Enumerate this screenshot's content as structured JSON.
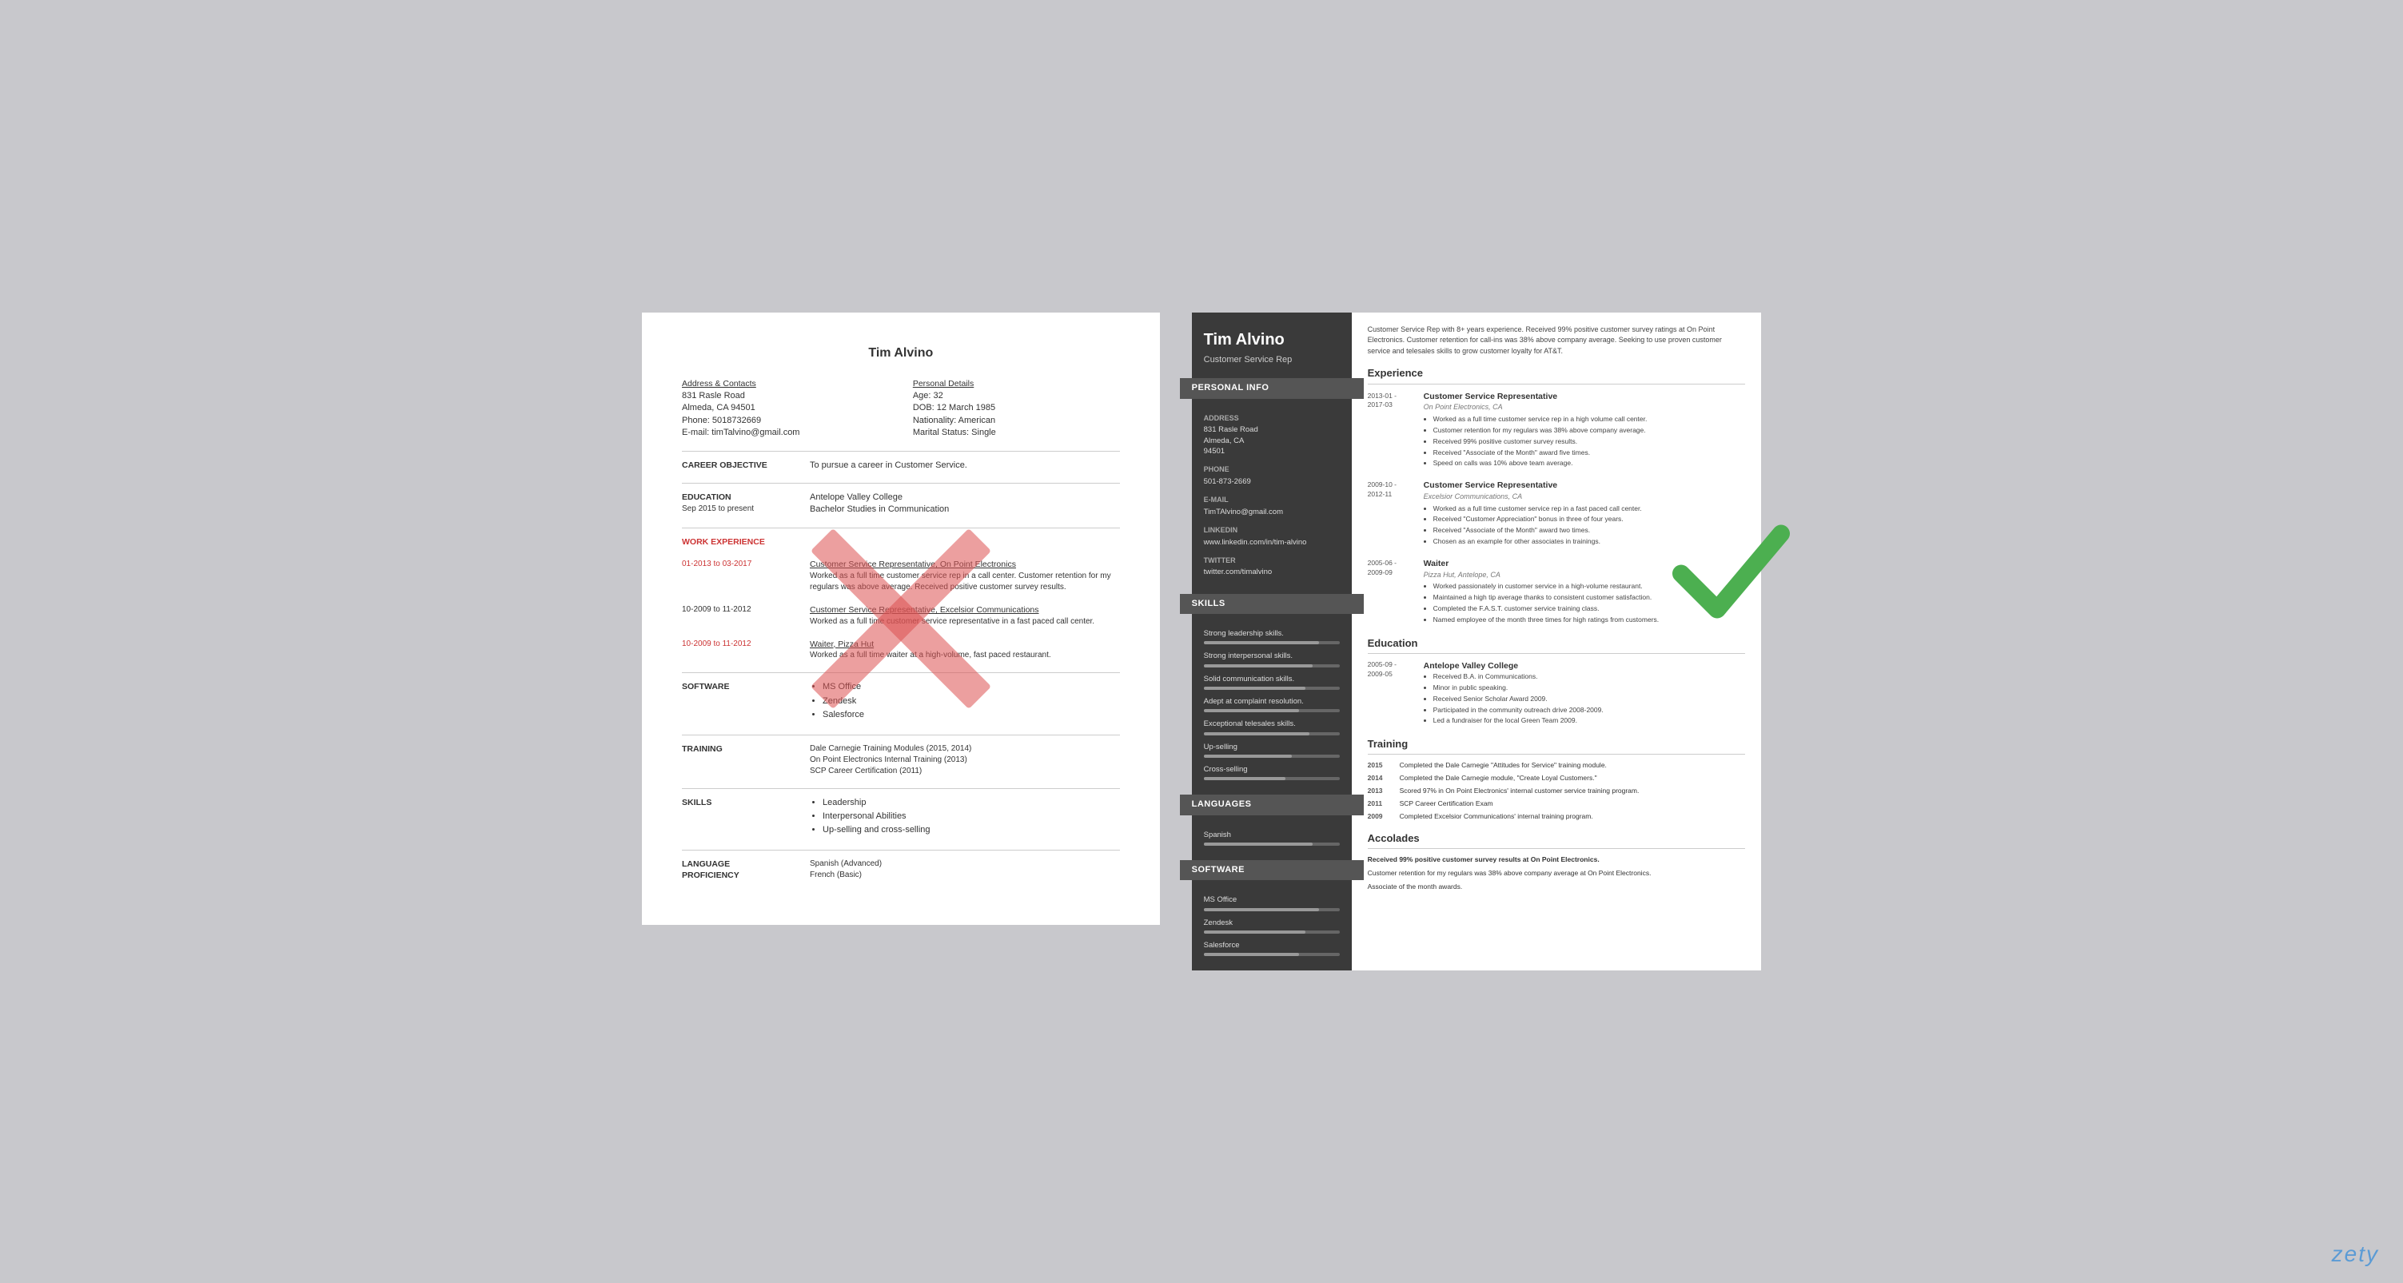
{
  "bad_resume": {
    "name": "Tim Alvino",
    "contact_left_label": "Address & Contacts",
    "address": "831 Rasle Road",
    "city_state": "Almeda, CA 94501",
    "phone": "Phone: 5018732669",
    "email": "E-mail: timTalvino@gmail.com",
    "contact_right_label": "Personal Details",
    "age": "Age:   32",
    "dob": "DOB:  12 March 1985",
    "nationality": "Nationality: American",
    "marital": "Marital Status: Single",
    "career_label": "CAREER OBJECTIVE",
    "career_text": "To pursue a career in Customer Service.",
    "education_label": "EDUCATION",
    "education_dates": "Sep 2015 to present",
    "education_school": "Antelope Valley College",
    "education_degree": "Bachelor Studies in Communication",
    "work_label": "WORK EXPERIENCE",
    "job1_dates": "01-2013 to 03-2017",
    "job1_title": "Customer Service Representative, On Point Electronics",
    "job1_desc": "Worked as a full time customer service rep in a call center. Customer retention for my regulars was above average. Received positive customer survey results.",
    "job2_dates": "10-2009 to 11-2012",
    "job2_title": "Customer Service Representative, Excelsior Communications",
    "job2_desc": "Worked as a full time customer service representative in a fast paced call center.",
    "job3_dates": "10-2009 to 11-2012",
    "job3_title": "Waiter, Pizza Hut",
    "job3_desc": "Worked as a full time waiter at a high-volume, fast paced restaurant.",
    "software_label": "SOFTWARE",
    "software_items": [
      "MS Office",
      "Zendesk",
      "Salesforce"
    ],
    "training_label": "TRAINING",
    "training_text": "Dale Carnegie Training Modules (2015, 2014)\nOn Point Electronics Internal Training (2013)\nSCP Career Certification (2011)",
    "skills_label": "SKILLS",
    "skills_items": [
      "Leadership",
      "Interpersonal Abilities",
      "Up-selling and cross-selling"
    ],
    "lang_label": "LANGUAGE PROFICIENCY",
    "lang_text": "Spanish (Advanced)\nFrench (Basic)"
  },
  "good_resume": {
    "name": "Tim Alvino",
    "title": "Customer Service Rep",
    "summary": "Customer Service Rep with 8+ years experience. Received 99% positive customer survey ratings at On Point Electronics. Customer retention for call-ins was 38% above company average. Seeking to use proven customer service and telesales skills to grow customer loyalty for AT&T.",
    "sections": {
      "personal_info": "Personal Info",
      "skills_title": "Skills",
      "languages_title": "Languages",
      "software_title": "Software"
    },
    "contact": {
      "address_label": "Address",
      "address": "831 Rasle Road\nAlmeda, CA\n94501",
      "phone_label": "Phone",
      "phone": "501-873-2669",
      "email_label": "E-mail",
      "email": "TimTAlvino@gmail.com",
      "linkedin_label": "LinkedIn",
      "linkedin": "www.linkedin.com/in/tim-alvino",
      "twitter_label": "Twitter",
      "twitter": "twitter.com/timalvino"
    },
    "skills": [
      {
        "name": "Strong leadership skills.",
        "pct": 85
      },
      {
        "name": "Strong interpersonal skills.",
        "pct": 80
      },
      {
        "name": "Solid communication skills.",
        "pct": 75
      },
      {
        "name": "Adept at complaint resolution.",
        "pct": 70
      },
      {
        "name": "Exceptional telesales skills.",
        "pct": 78
      },
      {
        "name": "Up-selling",
        "pct": 65
      },
      {
        "name": "Cross-selling",
        "pct": 60
      }
    ],
    "languages": [
      {
        "name": "Spanish",
        "pct": 80
      }
    ],
    "software": [
      {
        "name": "MS Office",
        "pct": 85
      },
      {
        "name": "Zendesk",
        "pct": 75
      },
      {
        "name": "Salesforce",
        "pct": 70
      }
    ],
    "experience_title": "Experience",
    "experience": [
      {
        "dates": "2013-01 -\n2017-03",
        "title": "Customer Service Representative",
        "company": "On Point Electronics, CA",
        "bullets": [
          "Worked as a full time customer service rep in a high volume call center.",
          "Customer retention for my regulars was 38% above company average.",
          "Received 99% positive customer survey results.",
          "Received \"Associate of the Month\" award five times.",
          "Speed on calls was 10% above team average."
        ]
      },
      {
        "dates": "2009-10 -\n2012-11",
        "title": "Customer Service Representative",
        "company": "Excelsior Communications, CA",
        "bullets": [
          "Worked as a full time customer service rep in a fast paced call center.",
          "Received \"Customer Appreciation\" bonus in three of four years.",
          "Received \"Associate of the Month\" award two times.",
          "Chosen as an example for other associates in trainings."
        ]
      },
      {
        "dates": "2005-06 -\n2009-09",
        "title": "Waiter",
        "company": "Pizza Hut, Antelope, CA",
        "bullets": [
          "Worked passionately in customer service in a high-volume restaurant.",
          "Maintained a high tip average thanks to consistent customer satisfaction.",
          "Completed the F.A.S.T. customer service training class.",
          "Named employee of the month three times for high ratings from customers."
        ]
      }
    ],
    "education_title": "Education",
    "education": [
      {
        "dates": "2005-09 -\n2009-05",
        "school": "Antelope Valley College",
        "bullets": [
          "Received B.A. in Communications.",
          "Minor in public speaking.",
          "Received Senior Scholar Award 2009.",
          "Participated in the community outreach drive 2008-2009.",
          "Led a fundraiser for the local Green Team 2009."
        ]
      }
    ],
    "training_title": "Training",
    "training": [
      {
        "year": "2015",
        "desc": "Completed the Dale Carnegie \"Attitudes for Service\" training module."
      },
      {
        "year": "2014",
        "desc": "Completed the Dale Carnegie module, \"Create Loyal Customers.\""
      },
      {
        "year": "2013",
        "desc": "Scored 97% in On Point Electronics' internal customer service training program."
      },
      {
        "year": "2011",
        "desc": "SCP Career Certification Exam"
      },
      {
        "year": "2009",
        "desc": "Completed Excelsior Communications' internal training program."
      }
    ],
    "accolades_title": "Accolades",
    "accolades": [
      "Received 99% positive customer survey results at On Point Electronics.",
      "Customer retention for my regulars was 38% above company average at On Point Electronics.",
      "Associate of the month awards."
    ]
  },
  "brand": "zety"
}
